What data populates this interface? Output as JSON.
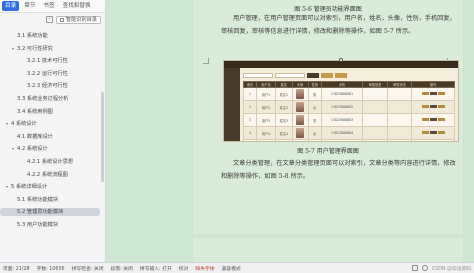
{
  "nav": {
    "tabs": [
      "目录",
      "章节",
      "书签",
      "查找和替换"
    ],
    "smart_button": "智能识别目录",
    "toc": [
      {
        "label": "3.1 系统功能",
        "level": 2
      },
      {
        "label": "3.2 可行性研究",
        "level": 2,
        "expanded": true
      },
      {
        "label": "3.2.1 技术可行性",
        "level": 3
      },
      {
        "label": "3.2.2 运行可行性",
        "level": 3
      },
      {
        "label": "3.2.3 经济可行性",
        "level": 3
      },
      {
        "label": "3.3 系统业务过程分析",
        "level": 2
      },
      {
        "label": "3.4 系统用例图",
        "level": 2
      },
      {
        "label": "4 系统设计",
        "level": 1,
        "expanded": true
      },
      {
        "label": "4.1 数据库设计",
        "level": 2
      },
      {
        "label": "4.2 系统设计",
        "level": 2,
        "expanded": true
      },
      {
        "label": "4.2.1 系统设计思想",
        "level": 3
      },
      {
        "label": "4.2.2 系统流程图",
        "level": 3
      },
      {
        "label": "5 系统详细设计",
        "level": 1,
        "expanded": true
      },
      {
        "label": "5.1 系统功能模块",
        "level": 2
      },
      {
        "label": "5.2 管理员功能模块",
        "level": 2,
        "selected": true
      },
      {
        "label": "5.3 用户功能模块",
        "level": 2
      }
    ]
  },
  "doc": {
    "caption_top": "图 5-6 管理员功能界面图",
    "para1": "用户管理，在用户管理页面可以对索引，用户名，姓名，头像，性别，手机回复，审核回复，审核等信息进行详情，修改和删除等操作，如图 5-7 所示。",
    "figure_caption": "图 5-7 用户管理界面图",
    "para2": "文章分类管理，在文章分类管理页面可以对索引，文章分类等内容进行详情，修改和删除等操作，如图 5-8 所示。",
    "float_tool": "⊞"
  },
  "figure": {
    "columns": [
      "索引",
      "用户名",
      "姓名",
      "头像",
      "性别",
      "手机",
      "审核回复",
      "审核状态",
      "操作"
    ],
    "rows": [
      [
        "1",
        "用户1",
        "姓名1",
        "",
        "男",
        "13823888881",
        "",
        "",
        ""
      ],
      [
        "2",
        "用户2",
        "姓名2",
        "",
        "女",
        "13823888882",
        "",
        "",
        ""
      ],
      [
        "3",
        "用户3",
        "姓名3",
        "",
        "男",
        "13823888883",
        "",
        "",
        ""
      ],
      [
        "4",
        "用户4",
        "姓名4",
        "",
        "女",
        "13823888884",
        "",
        "",
        ""
      ],
      [
        "5",
        "用户5",
        "姓名5",
        "",
        "男",
        "13823888885",
        "",
        "",
        ""
      ]
    ]
  },
  "status": {
    "page": "页面: 21/28",
    "words": "字数: 10656",
    "spell": "拼写检查: 关闭",
    "paragraph": "段落: 关闭",
    "input_method": "拼写输入: 打开",
    "proofread": "校对",
    "missing_font": "缺失字体",
    "compat": "兼容模式",
    "watermark": "CSDN @毕设源码"
  },
  "colors": {
    "accent": "#2f6fe0",
    "canvas": "#cfe6d2",
    "page": "#d9ecd9",
    "figure_dark": "#4a3a2a"
  }
}
